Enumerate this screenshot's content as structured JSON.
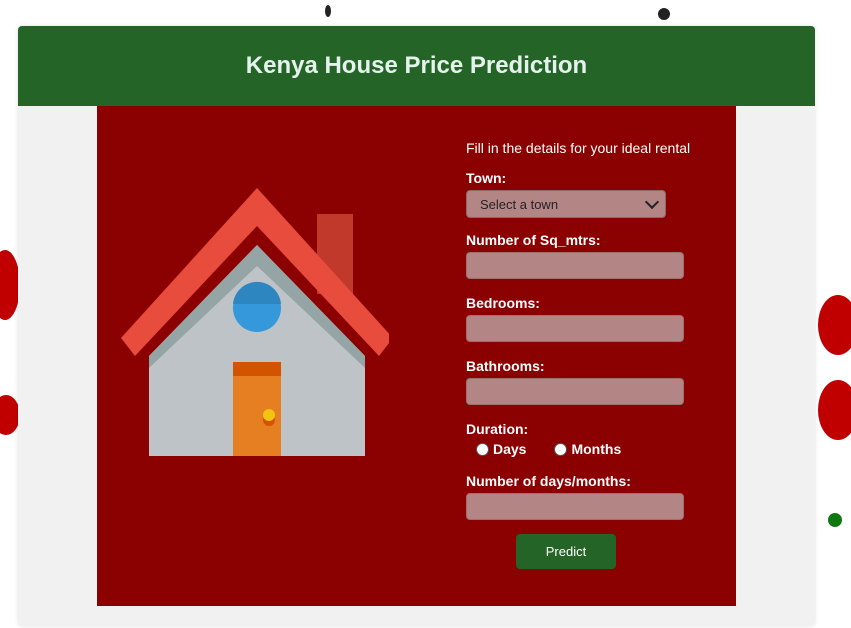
{
  "header": {
    "title": "Kenya House Price Prediction"
  },
  "form": {
    "intro": "Fill in the details for your ideal rental",
    "town_label": "Town:",
    "town_selected": "Select a town",
    "sqm_label": "Number of Sq_mtrs:",
    "bedrooms_label": "Bedrooms:",
    "bathrooms_label": "Bathrooms:",
    "duration_label": "Duration:",
    "duration_options": [
      "Days",
      "Months"
    ],
    "count_label": "Number of days/months:",
    "submit_label": "Predict"
  },
  "colors": {
    "header": "#256427",
    "panel": "#8b0000",
    "input": "#b48585",
    "button": "#256427"
  },
  "icons": {
    "illustration": "house-icon"
  }
}
